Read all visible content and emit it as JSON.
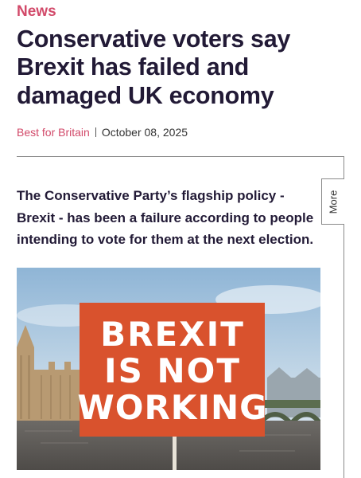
{
  "article": {
    "category": "News",
    "headline": "Conservative voters say Brexit has failed and damaged UK economy",
    "source": "Best for Britain",
    "date": "October 08, 2025",
    "lede": "The Conservative Party’s flagship policy - Brexit - has been a failure according to people intending to vote for them at the next election.",
    "more_tab": "More"
  },
  "image": {
    "sign_lines": [
      "BREXIT",
      "IS NOT",
      "WORKING"
    ],
    "sign_color": "#d9522d"
  },
  "colors": {
    "accent": "#d24a6a",
    "headline": "#221a36"
  }
}
